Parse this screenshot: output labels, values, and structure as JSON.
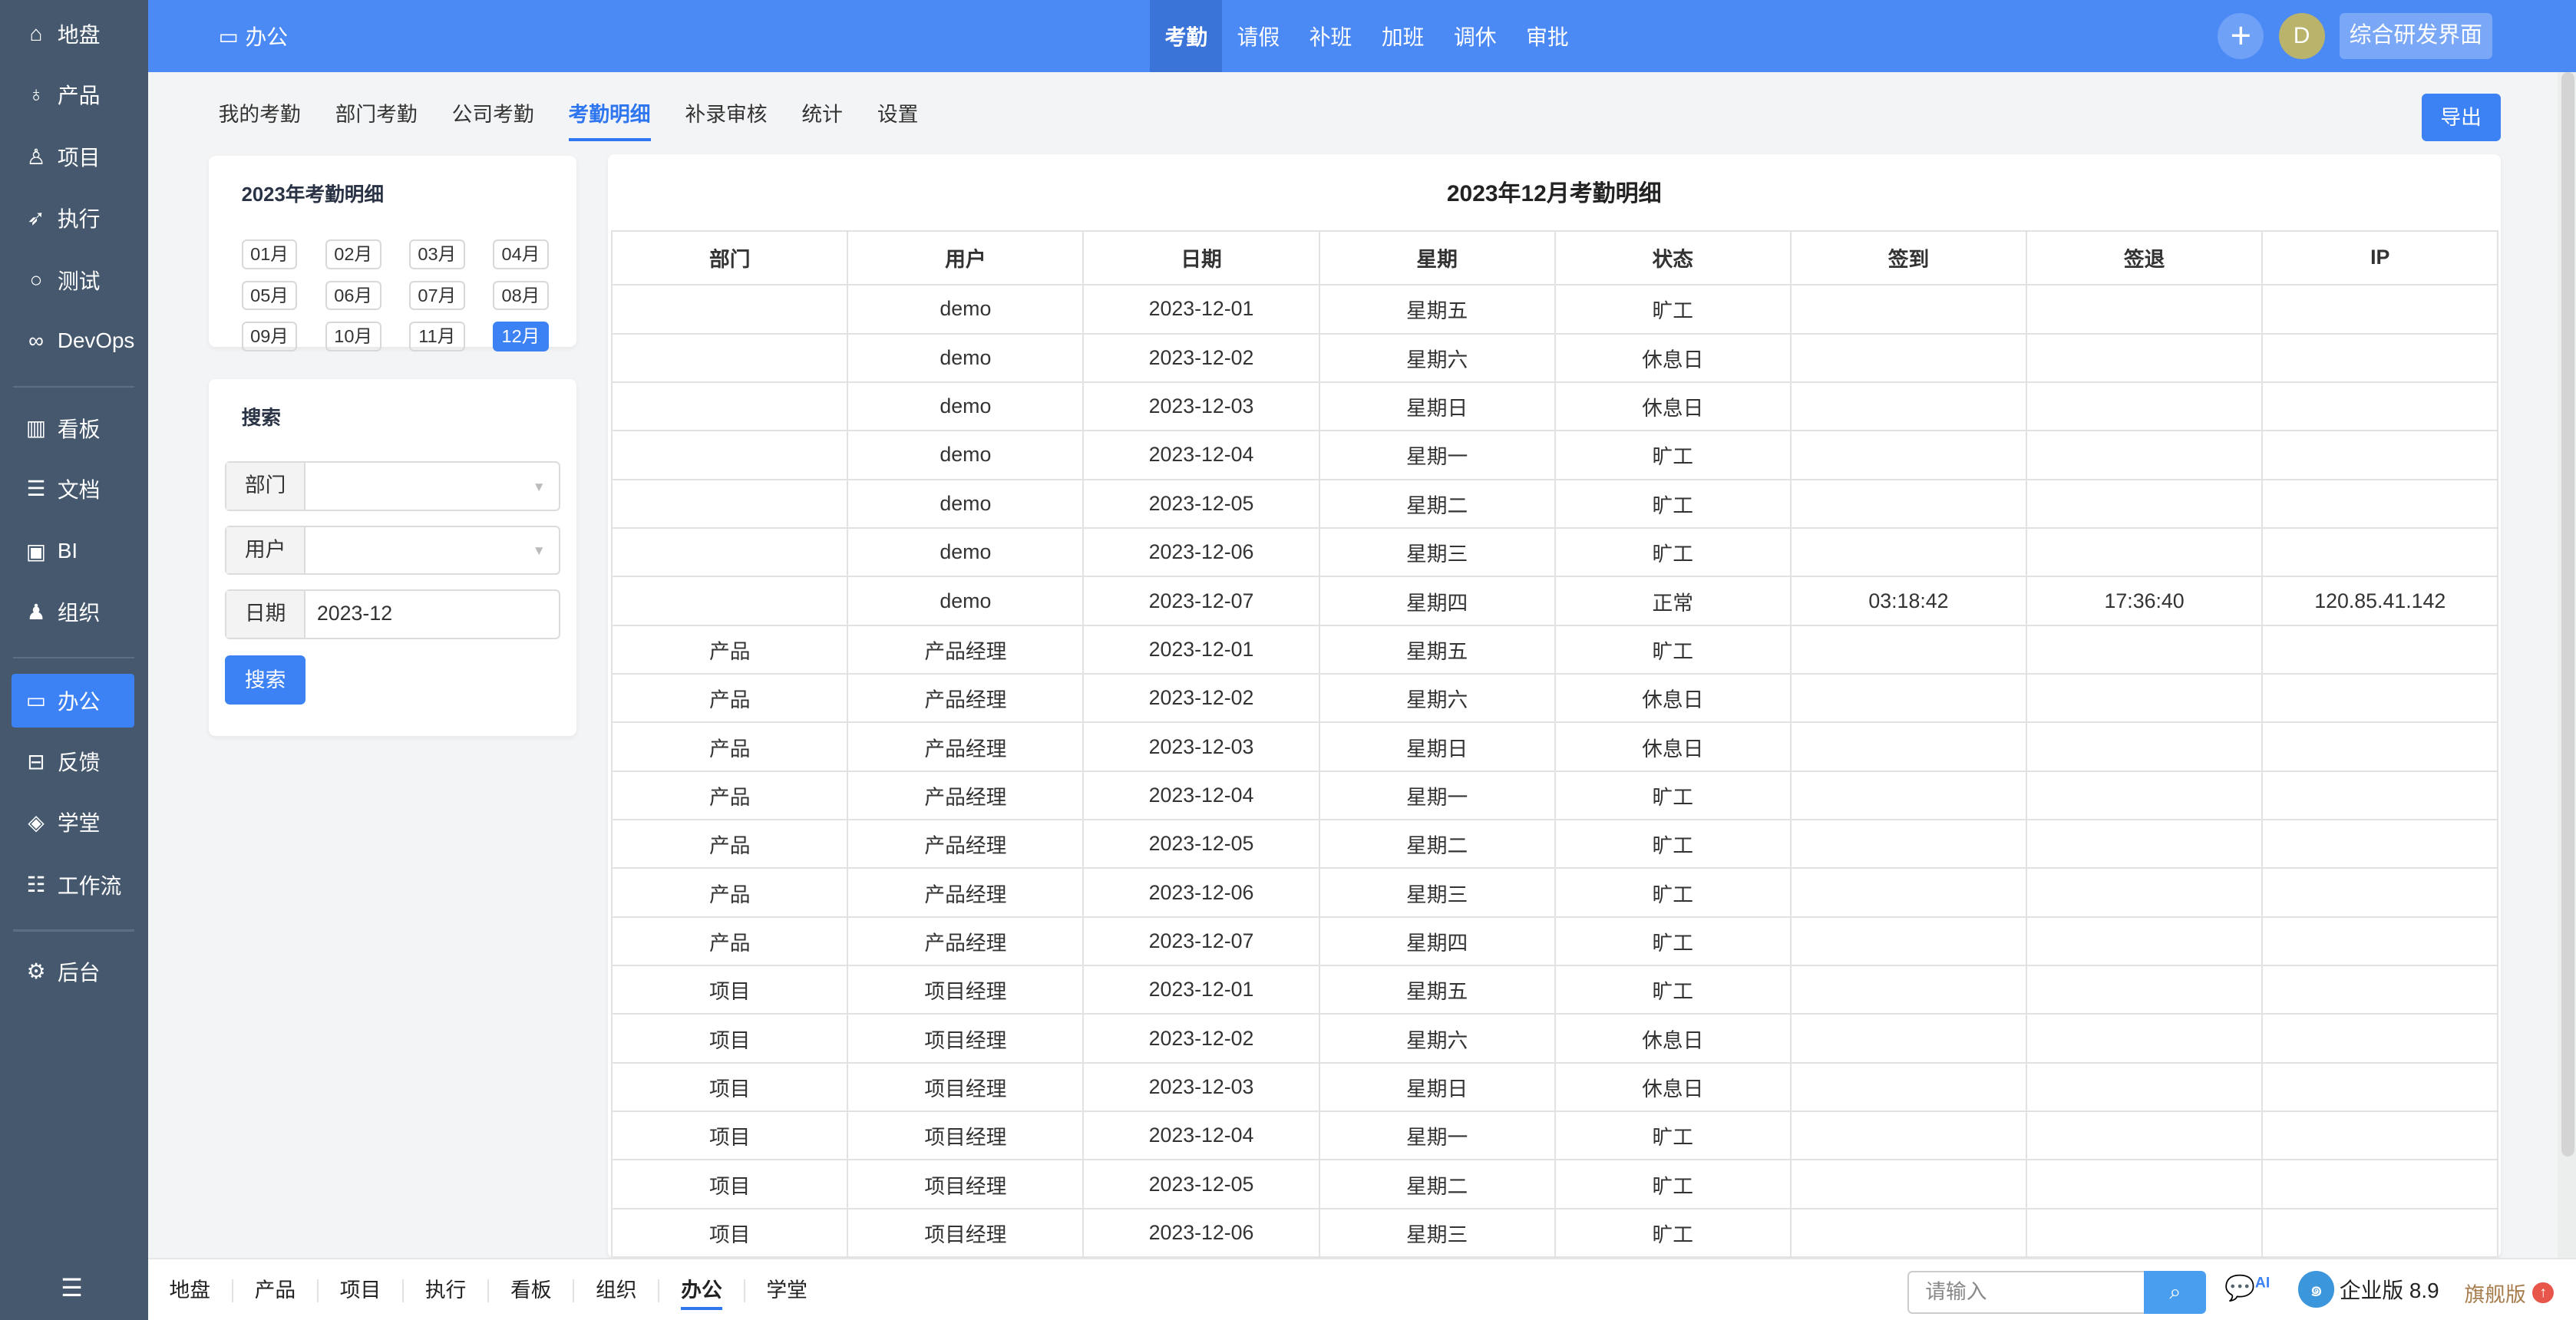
{
  "sidebar": {
    "items": [
      {
        "label": "地盘",
        "icon": "home-icon",
        "glyph": "⌂"
      },
      {
        "label": "产品",
        "icon": "lightbulb-icon",
        "glyph": "♁"
      },
      {
        "label": "项目",
        "icon": "rocket-icon",
        "glyph": "♙"
      },
      {
        "label": "执行",
        "icon": "running-icon",
        "glyph": "➶"
      },
      {
        "label": "测试",
        "icon": "magnifier-icon",
        "glyph": "○"
      },
      {
        "label": "DevOps",
        "icon": "infinity-icon",
        "glyph": "∞"
      },
      {
        "label": "看板",
        "icon": "kanban-icon",
        "glyph": "▥"
      },
      {
        "label": "文档",
        "icon": "document-icon",
        "glyph": "☰"
      },
      {
        "label": "BI",
        "icon": "monitor-chart-icon",
        "glyph": "▣"
      },
      {
        "label": "组织",
        "icon": "user-icon",
        "glyph": "♟"
      },
      {
        "label": "办公",
        "icon": "oa-icon",
        "glyph": "▭",
        "active": true
      },
      {
        "label": "反馈",
        "icon": "inbox-icon",
        "glyph": "⊟"
      },
      {
        "label": "学堂",
        "icon": "cube-icon",
        "glyph": "◈"
      },
      {
        "label": "工作流",
        "icon": "workflow-icon",
        "glyph": "☷"
      },
      {
        "label": "后台",
        "icon": "gear-icon",
        "glyph": "⚙"
      }
    ]
  },
  "header": {
    "app_title": "办公",
    "tabs": [
      "考勤",
      "请假",
      "补班",
      "加班",
      "调休",
      "审批"
    ],
    "active_tab": "考勤",
    "avatar": "D",
    "workspace_button": "综合研发界面"
  },
  "subtabs": {
    "items": [
      "我的考勤",
      "部门考勤",
      "公司考勤",
      "考勤明细",
      "补录审核",
      "统计",
      "设置"
    ],
    "active": "考勤明细"
  },
  "export_label": "导出",
  "year_card": {
    "title": "2023年考勤明细",
    "months": [
      "01月",
      "02月",
      "03月",
      "04月",
      "05月",
      "06月",
      "07月",
      "08月",
      "09月",
      "10月",
      "11月",
      "12月"
    ],
    "active": "12月"
  },
  "search_card": {
    "title": "搜索",
    "dept_label": "部门",
    "dept_value": "",
    "user_label": "用户",
    "user_value": "",
    "date_label": "日期",
    "date_value": "2023-12",
    "button": "搜索"
  },
  "table": {
    "title": "2023年12月考勤明细",
    "columns": [
      "部门",
      "用户",
      "日期",
      "星期",
      "状态",
      "签到",
      "签退",
      "IP"
    ],
    "rows": [
      [
        "",
        "demo",
        "2023-12-01",
        "星期五",
        "旷工",
        "",
        "",
        ""
      ],
      [
        "",
        "demo",
        "2023-12-02",
        "星期六",
        "休息日",
        "",
        "",
        ""
      ],
      [
        "",
        "demo",
        "2023-12-03",
        "星期日",
        "休息日",
        "",
        "",
        ""
      ],
      [
        "",
        "demo",
        "2023-12-04",
        "星期一",
        "旷工",
        "",
        "",
        ""
      ],
      [
        "",
        "demo",
        "2023-12-05",
        "星期二",
        "旷工",
        "",
        "",
        ""
      ],
      [
        "",
        "demo",
        "2023-12-06",
        "星期三",
        "旷工",
        "",
        "",
        ""
      ],
      [
        "",
        "demo",
        "2023-12-07",
        "星期四",
        "正常",
        "03:18:42",
        "17:36:40",
        "120.85.41.142"
      ],
      [
        "产品",
        "产品经理",
        "2023-12-01",
        "星期五",
        "旷工",
        "",
        "",
        ""
      ],
      [
        "产品",
        "产品经理",
        "2023-12-02",
        "星期六",
        "休息日",
        "",
        "",
        ""
      ],
      [
        "产品",
        "产品经理",
        "2023-12-03",
        "星期日",
        "休息日",
        "",
        "",
        ""
      ],
      [
        "产品",
        "产品经理",
        "2023-12-04",
        "星期一",
        "旷工",
        "",
        "",
        ""
      ],
      [
        "产品",
        "产品经理",
        "2023-12-05",
        "星期二",
        "旷工",
        "",
        "",
        ""
      ],
      [
        "产品",
        "产品经理",
        "2023-12-06",
        "星期三",
        "旷工",
        "",
        "",
        ""
      ],
      [
        "产品",
        "产品经理",
        "2023-12-07",
        "星期四",
        "旷工",
        "",
        "",
        ""
      ],
      [
        "项目",
        "项目经理",
        "2023-12-01",
        "星期五",
        "旷工",
        "",
        "",
        ""
      ],
      [
        "项目",
        "项目经理",
        "2023-12-02",
        "星期六",
        "休息日",
        "",
        "",
        ""
      ],
      [
        "项目",
        "项目经理",
        "2023-12-03",
        "星期日",
        "休息日",
        "",
        "",
        ""
      ],
      [
        "项目",
        "项目经理",
        "2023-12-04",
        "星期一",
        "旷工",
        "",
        "",
        ""
      ],
      [
        "项目",
        "项目经理",
        "2023-12-05",
        "星期二",
        "旷工",
        "",
        "",
        ""
      ],
      [
        "项目",
        "项目经理",
        "2023-12-06",
        "星期三",
        "旷工",
        "",
        "",
        ""
      ]
    ]
  },
  "bottombar": {
    "tabs": [
      "地盘",
      "产品",
      "项目",
      "执行",
      "看板",
      "组织",
      "办公",
      "学堂"
    ],
    "active": "办公",
    "search_placeholder": "请输入",
    "ai_label": "AI",
    "edition": "企业版 8.9",
    "flagship": "旗舰版"
  },
  "colors": {
    "accent": "#3d82f5",
    "topbar": "#4b89f5",
    "sidebar": "#45586d"
  }
}
